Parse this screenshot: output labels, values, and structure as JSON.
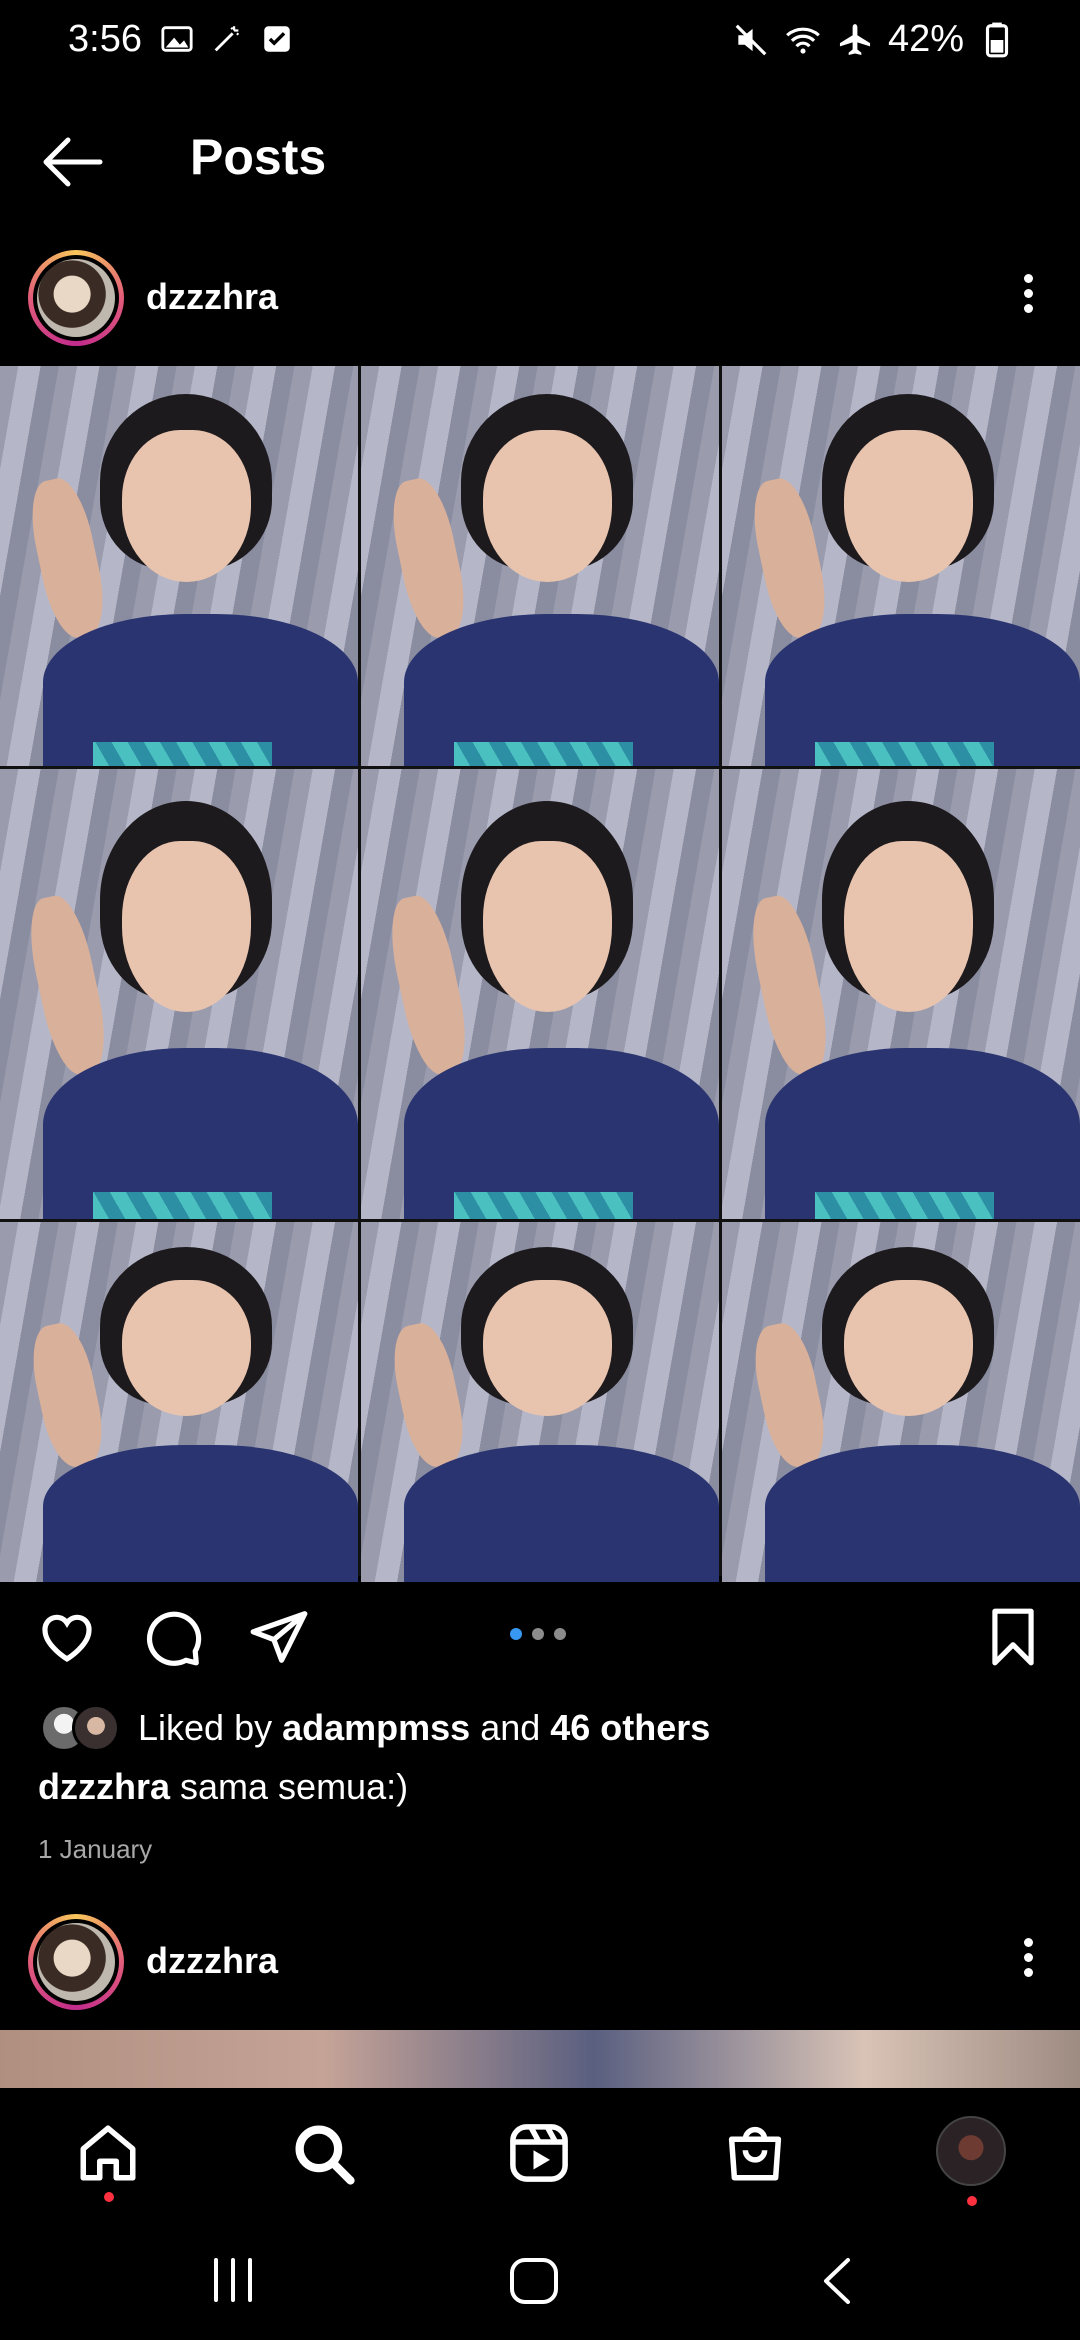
{
  "status_bar": {
    "time": "3:56",
    "battery": "42%"
  },
  "header": {
    "title": "Posts"
  },
  "post1": {
    "username": "dzzzhra",
    "carousel": {
      "current_index": 1,
      "total": 3
    },
    "likes": {
      "prefix": "Liked by ",
      "first_user": "adampmss",
      "middle": " and ",
      "others": "46 others"
    },
    "caption": {
      "username": "dzzzhra",
      "text": " sama semua:)"
    },
    "date": "1 January"
  },
  "post2": {
    "username": "dzzzhra"
  },
  "icons": {
    "back": "arrow-left-icon",
    "more": "more-vertical-icon",
    "like": "heart-icon",
    "comment": "comment-icon",
    "share": "send-icon",
    "save": "bookmark-icon",
    "home": "home-icon",
    "search": "search-icon",
    "reels": "reels-icon",
    "shop": "shop-icon"
  },
  "colors": {
    "background": "#000000",
    "accent": "#3897f0",
    "notification": "#ff3040"
  }
}
